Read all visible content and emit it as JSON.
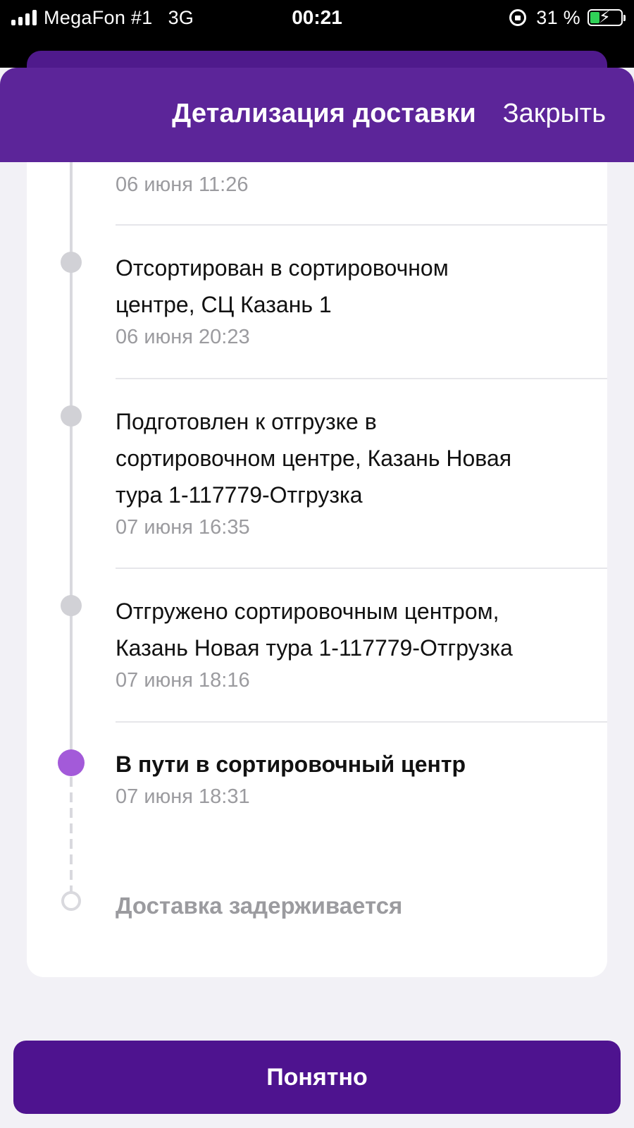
{
  "status_bar": {
    "carrier": "MegaFon #1",
    "network": "3G",
    "time": "00:21",
    "battery_percent": "31 %",
    "battery_level": 0.31,
    "signal_bars": 4
  },
  "header": {
    "title": "Детализация доставки",
    "close_label": "Закрыть"
  },
  "timeline": {
    "partial_event": {
      "date": "06 июня 11:26"
    },
    "events": [
      {
        "title_line1": "Отсортирован в сортировочном",
        "title_line2": "центре, СЦ Казань 1",
        "date": "06 июня 20:23"
      },
      {
        "title_line1": "Подготовлен к отгрузке в",
        "title_line2": "сортировочном центре, Казань Новая",
        "title_line3": "тура 1-117779-Отгрузка",
        "date": "07 июня 16:35"
      },
      {
        "title_line1": "Отгружено сортировочным центром,",
        "title_line2": "Казань Новая тура 1-117779-Отгрузка",
        "date": "07 июня 18:16"
      }
    ],
    "current_event": {
      "title": "В пути в сортировочный центр",
      "date": "07 июня 18:31"
    },
    "pending_label": "Доставка задерживается"
  },
  "colors": {
    "header": "#5c2599",
    "button": "#4e138f",
    "active_dot": "#a35ad9",
    "battery": "#30d158"
  },
  "actions": {
    "ok_label": "Понятно"
  }
}
